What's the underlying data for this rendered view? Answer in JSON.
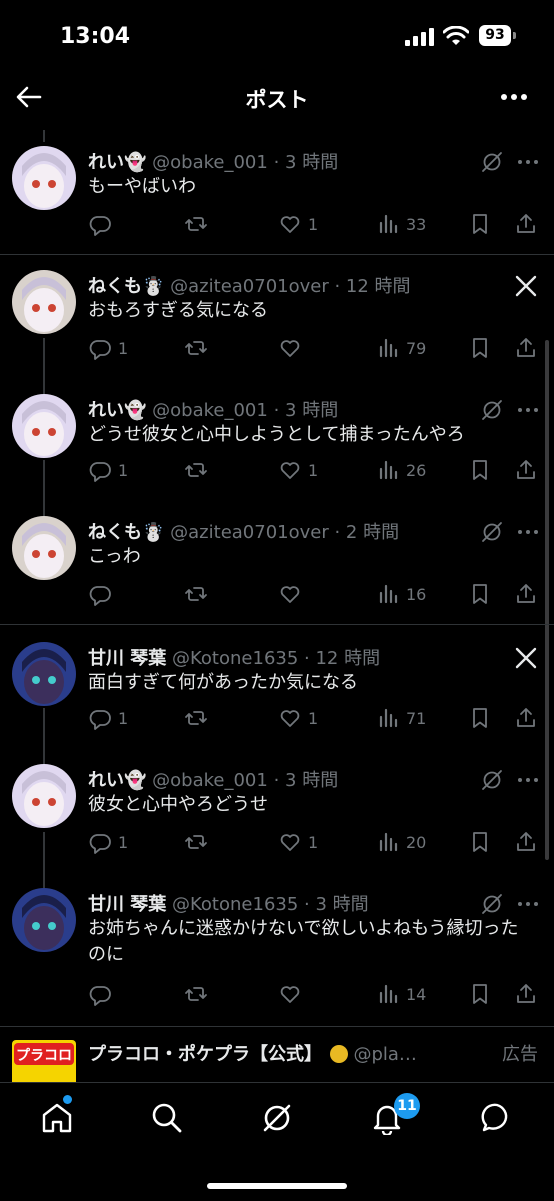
{
  "status": {
    "time": "13:04",
    "battery": "93"
  },
  "header": {
    "title": "ポスト"
  },
  "tweets": [
    {
      "name": "れい👻",
      "handle": "@obake_001",
      "time": "3 時間",
      "text": "もーやばいわ",
      "reply": "",
      "like": "1",
      "views": "33",
      "avatar_color": "#e0d8f0",
      "top_icon": "grok-icon"
    },
    {
      "name": "ねくも☃️",
      "handle": "@azitea0701over",
      "time": "12 時間",
      "text": "おもろすぎる気になる",
      "reply": "1",
      "like": "",
      "views": "79",
      "avatar_color": "#d9d2cc",
      "top_icon": "x-logo-icon"
    },
    {
      "name": "れい👻",
      "handle": "@obake_001",
      "time": "3 時間",
      "text": "どうせ彼女と心中しようとして捕まったんやろ",
      "reply": "1",
      "like": "1",
      "views": "26",
      "avatar_color": "#e0d8f0",
      "top_icon": "grok-icon"
    },
    {
      "name": "ねくも☃️",
      "handle": "@azitea0701over",
      "time": "2 時間",
      "text": "こっわ",
      "reply": "",
      "like": "",
      "views": "16",
      "avatar_color": "#d9d2cc",
      "top_icon": "grok-icon"
    },
    {
      "name": "甘川 琴葉",
      "handle": "@Kotone1635",
      "time": "12 時間",
      "text": "面白すぎて何があったか気になる",
      "reply": "1",
      "like": "1",
      "views": "71",
      "avatar_color": "#2a3d8c",
      "top_icon": "x-logo-icon"
    },
    {
      "name": "れい👻",
      "handle": "@obake_001",
      "time": "3 時間",
      "text": "彼女と心中やろどうせ",
      "reply": "1",
      "like": "1",
      "views": "20",
      "avatar_color": "#e0d8f0",
      "top_icon": "grok-icon"
    },
    {
      "name": "甘川 琴葉",
      "handle": "@Kotone1635",
      "time": "3 時間",
      "text": "お姉ちゃんに迷惑かけないで欲しいよねもう縁切ったのに",
      "reply": "",
      "like": "",
      "views": "14",
      "avatar_color": "#2a3d8c",
      "top_icon": "grok-icon"
    }
  ],
  "ad": {
    "name": "プラコロ・ポケプラ【公式】",
    "handle": "@pla…",
    "label": "広告",
    "logo_text": "プラコロ"
  },
  "tabbar": {
    "badge": "11"
  },
  "colors": {
    "accent": "#1d9bf0",
    "muted": "#71767b",
    "background": "#000000"
  }
}
